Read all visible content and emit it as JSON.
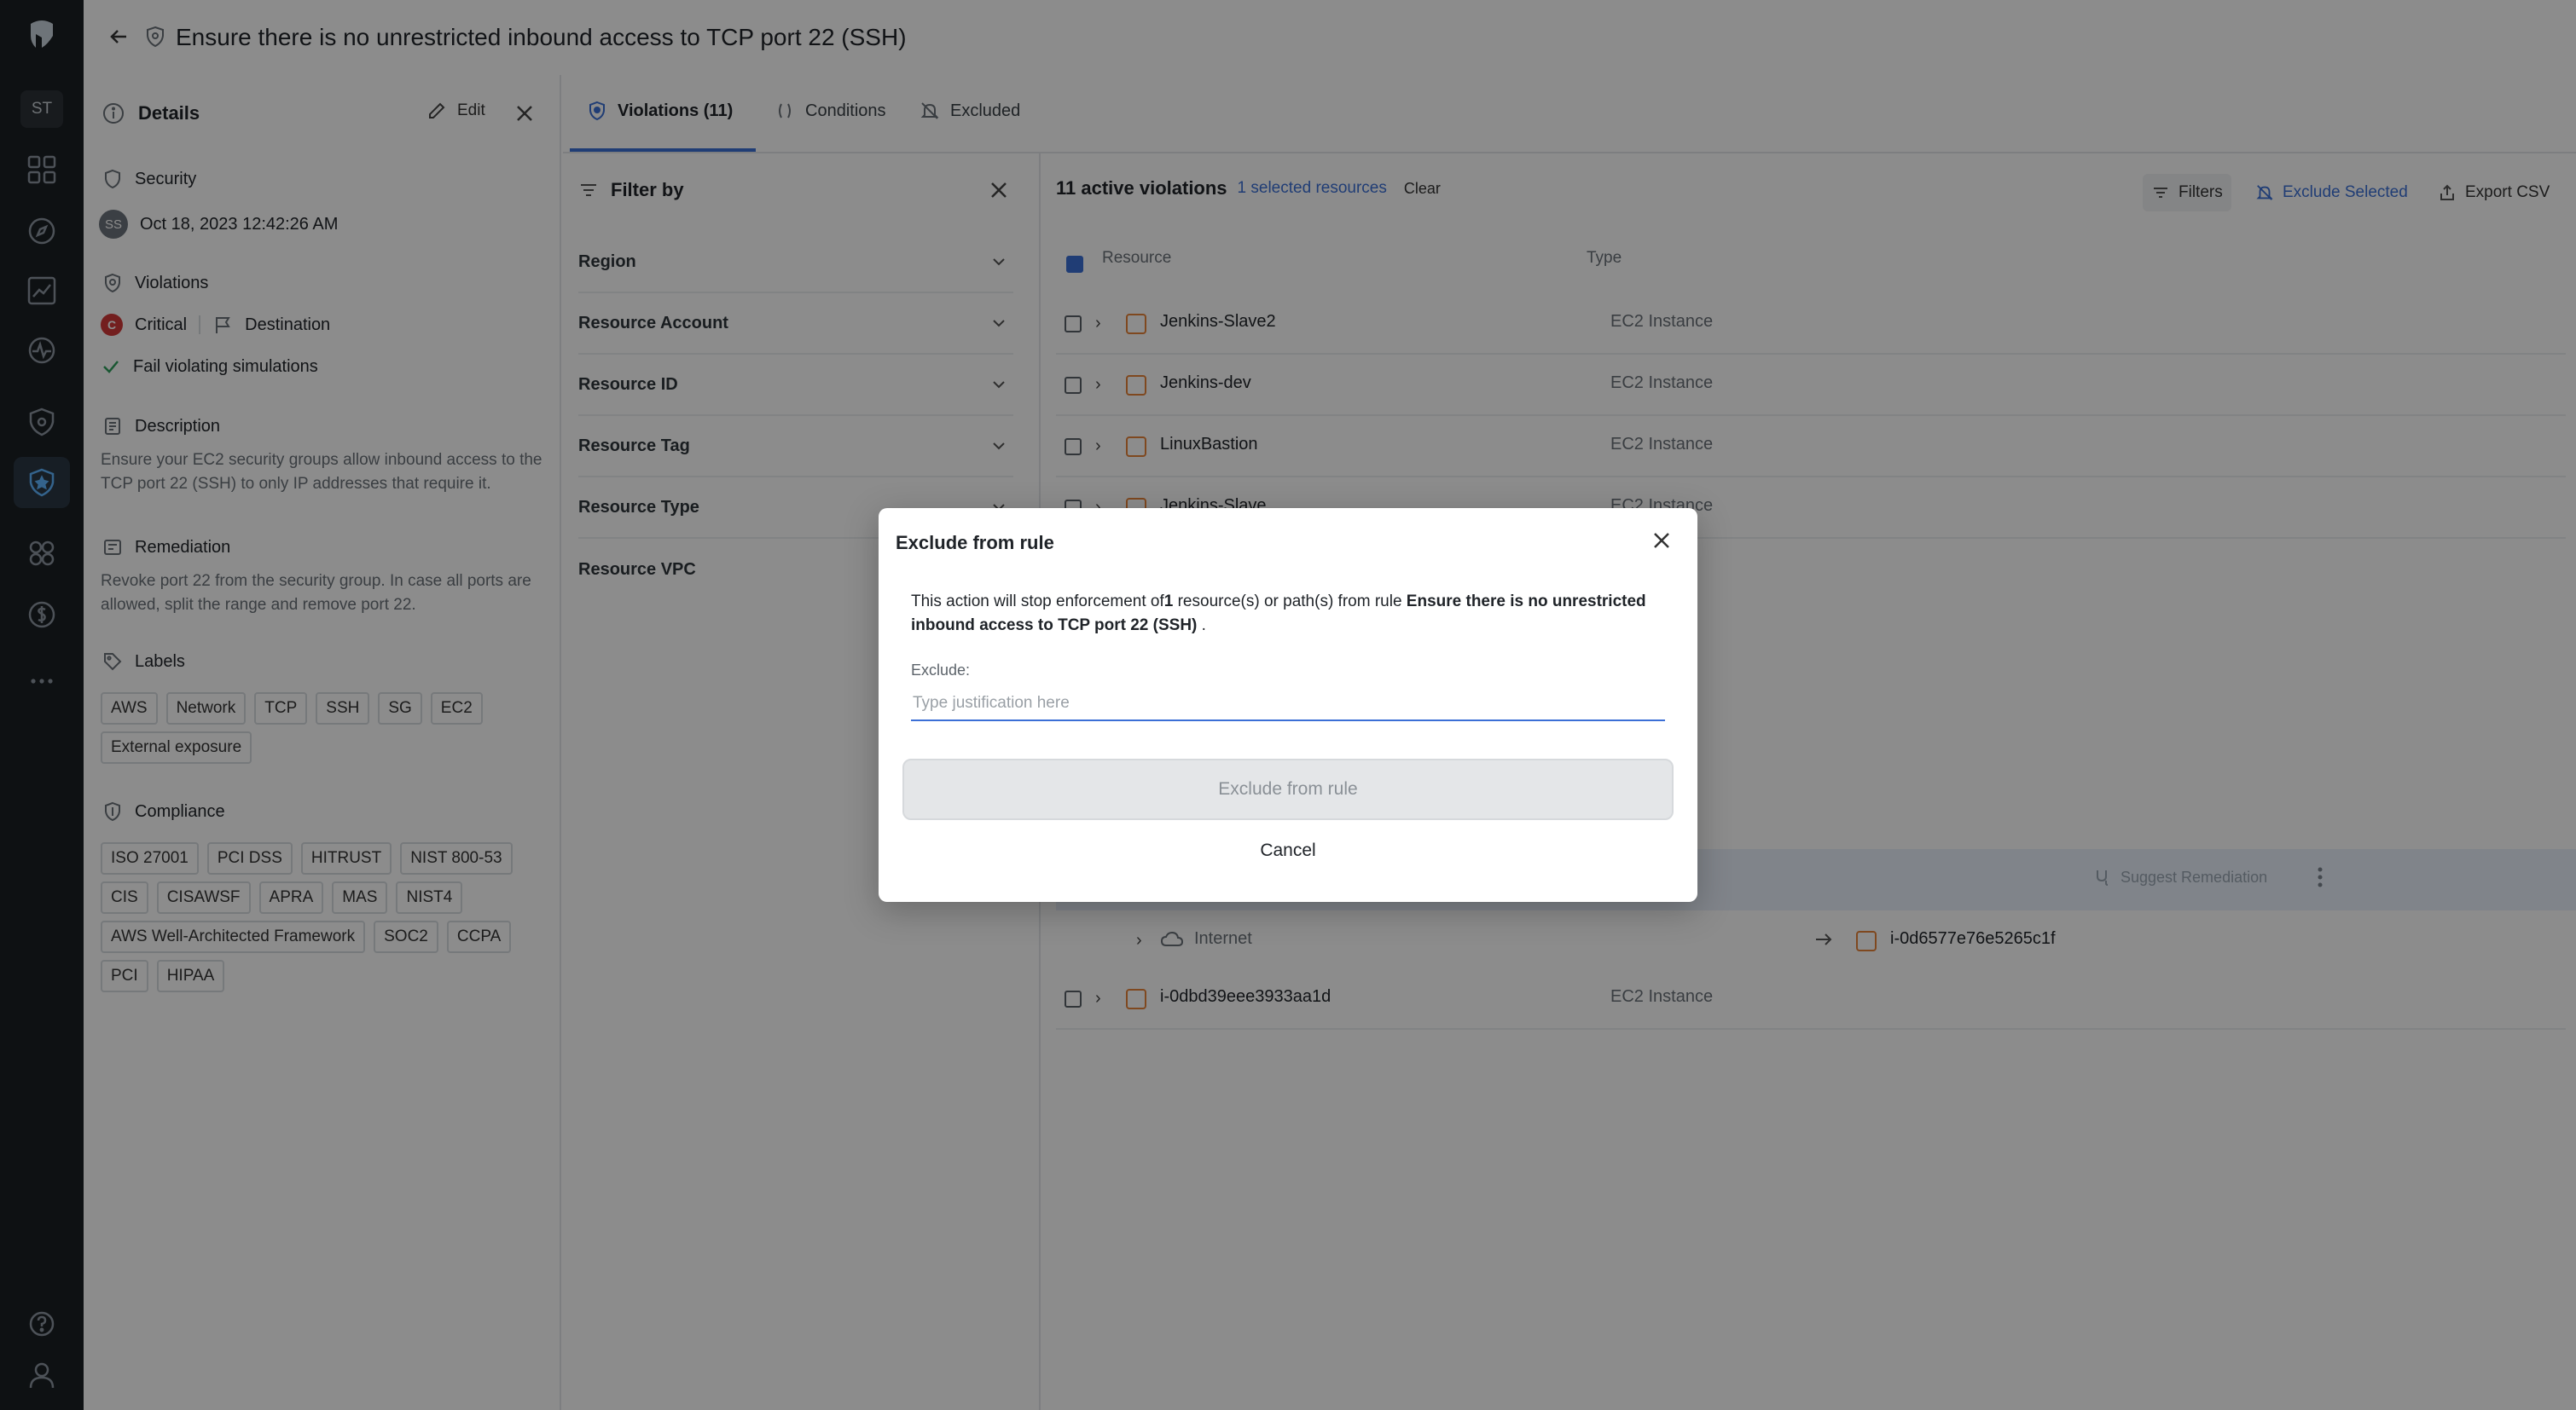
{
  "header": {
    "title": "Ensure there is no unrestricted inbound access to TCP port 22 (SSH)"
  },
  "rail": {
    "avatar": "ST"
  },
  "details": {
    "title": "Details",
    "edit_label": "Edit",
    "category": "Security",
    "author_initials": "SS",
    "timestamp": "Oct 18, 2023 12:42:26 AM",
    "violations_label": "Violations",
    "severity_badge": "C",
    "severity": "Critical",
    "destination": "Destination",
    "fail_label": "Fail violating simulations",
    "description_label": "Description",
    "description": "Ensure your EC2 security groups allow inbound access to the TCP port 22 (SSH) to only IP addresses that require it.",
    "remediation_label": "Remediation",
    "remediation": "Revoke port 22 from the security group. In case all ports are allowed, split the range and remove port 22.",
    "labels_label": "Labels",
    "labels": [
      "AWS",
      "Network",
      "TCP",
      "SSH",
      "SG",
      "EC2",
      "External exposure"
    ],
    "compliance_label": "Compliance",
    "compliance": [
      "ISO 27001",
      "PCI DSS",
      "HITRUST",
      "NIST 800-53",
      "CIS",
      "CISAWSF",
      "APRA",
      "MAS",
      "NIST4",
      "AWS Well-Architected Framework",
      "SOC2",
      "CCPA",
      "PCI",
      "HIPAA"
    ]
  },
  "tabs": [
    {
      "label": "Violations (11)",
      "active": true
    },
    {
      "label": "Conditions",
      "active": false
    },
    {
      "label": "Excluded",
      "active": false
    }
  ],
  "filter": {
    "title": "Filter by",
    "items": [
      "Region",
      "Resource Account",
      "Resource ID",
      "Resource Tag",
      "Resource Type",
      "Resource VPC"
    ]
  },
  "table": {
    "active_count": "11 active violations",
    "selected": "1 selected resources",
    "clear": "Clear",
    "filters_btn": "Filters",
    "exclude_btn": "Exclude Selected",
    "export_btn": "Export CSV",
    "col_resource": "Resource",
    "col_type": "Type",
    "rows": [
      {
        "name": "Jenkins-Slave2",
        "type": "EC2 Instance"
      },
      {
        "name": "Jenkins-dev",
        "type": "EC2 Instance"
      },
      {
        "name": "LinuxBastion",
        "type": "EC2 Instance"
      },
      {
        "name": "Jenkins-Slave",
        "type": "EC2 Instance"
      }
    ],
    "suggest_remediation": "Suggest Remediation",
    "path": {
      "source": "Internet",
      "target": "i-0d6577e76e5265c1f"
    },
    "last_row": {
      "name": "i-0dbd39eee3933aa1d",
      "type": "EC2 Instance"
    }
  },
  "modal": {
    "title": "Exclude from rule",
    "msg_prefix": "This action will stop enforcement of",
    "msg_count": "1",
    "msg_middle": " resource(s) or path(s) from rule ",
    "msg_rule": "Ensure there is no unrestricted inbound access to TCP port 22 (SSH)",
    "msg_suffix": " .",
    "exclude_label": "Exclude:",
    "placeholder": "Type justification here",
    "primary_button": "Exclude from rule",
    "cancel": "Cancel"
  },
  "colors": {
    "accent": "#3b6fd6",
    "critical": "#d23a3a",
    "ec2": "#e8843a",
    "rail": "#1b1f24"
  }
}
